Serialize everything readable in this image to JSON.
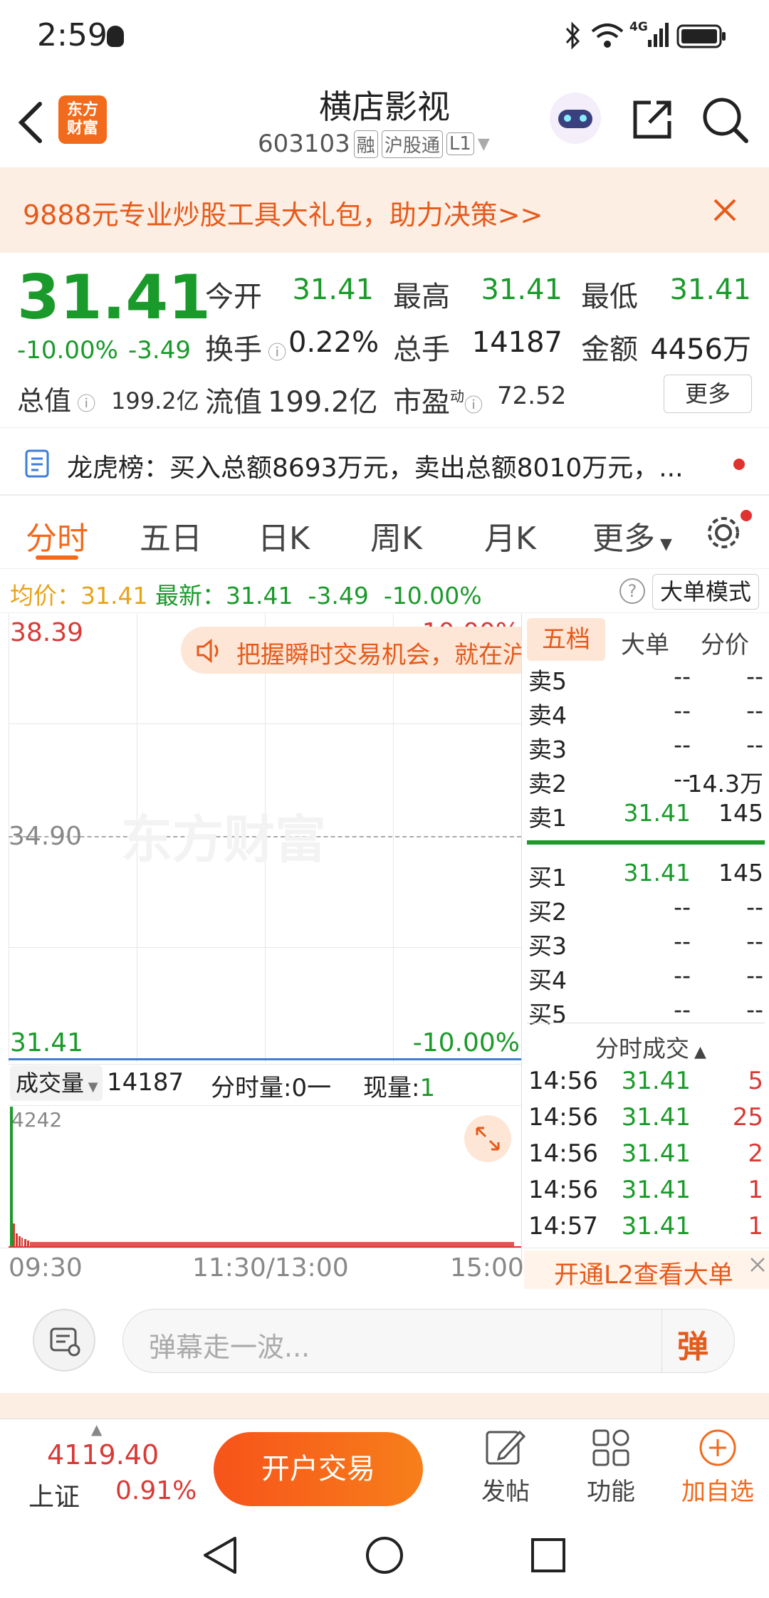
{
  "status_bar": {
    "time": "2:59",
    "network": "4G"
  },
  "header": {
    "title": "横店影视",
    "code": "603103",
    "tags": [
      "融",
      "沪股通",
      "L1"
    ],
    "logo_text": "东方\n财富"
  },
  "banner": {
    "text": "9888元专业炒股工具大礼包，助力决策>>"
  },
  "quote": {
    "price": "31.41",
    "change_pct": "-10.00%",
    "change": "-3.49",
    "open_label": "今开",
    "open": "31.41",
    "high_label": "最高",
    "high": "31.41",
    "low_label": "最低",
    "low": "31.41",
    "turnover_label": "换手",
    "turnover": "0.22%",
    "volume_label": "总手",
    "volume": "14187",
    "amount_label": "金额",
    "amount": "4456万",
    "mktcap_label": "总值",
    "mktcap": "199.2亿",
    "float_label": "流值",
    "float": "199.2亿",
    "pe_label": "市盈",
    "pe_sup": "动",
    "pe": "72.52",
    "more_button": "更多"
  },
  "news": {
    "text": "龙虎榜：买入总额8693万元，卖出总额8010万元，..."
  },
  "tabs": [
    "分时",
    "五日",
    "日K",
    "周K",
    "月K",
    "更多"
  ],
  "info_line": {
    "avg_label": "均价：",
    "avg": "31.41",
    "latest_label": "最新：",
    "latest": "31.41",
    "change": "-3.49",
    "change_pct": "-10.00%",
    "mode_button": "大单模式"
  },
  "chart": {
    "top_price": "38.39",
    "top_pct": "10.00%",
    "mid_price": "34.90",
    "bottom_price": "31.41",
    "bottom_pct": "-10.00%",
    "watermark": "东方财富",
    "promo": "把握瞬时交易机会，就在沪",
    "volume_label": "成交量",
    "volume": "14187",
    "minute_vol_label": "分时量:0一",
    "current_vol_label": "现量:",
    "current_vol": "1",
    "vol_max": "4242",
    "time_labels": [
      "09:30",
      "11:30/13:00",
      "15:00"
    ]
  },
  "order_book": {
    "tabs": [
      "五档",
      "大单",
      "分价"
    ],
    "sell": [
      {
        "label": "卖5",
        "price": "--",
        "vol": "--"
      },
      {
        "label": "卖4",
        "price": "--",
        "vol": "--"
      },
      {
        "label": "卖3",
        "price": "--",
        "vol": "--"
      },
      {
        "label": "卖2",
        "price": "--",
        "vol": "14.3万"
      },
      {
        "label": "卖1",
        "price": "31.41",
        "vol": "145"
      }
    ],
    "buy": [
      {
        "label": "买1",
        "price": "31.41",
        "vol": "145"
      },
      {
        "label": "买2",
        "price": "--",
        "vol": "--"
      },
      {
        "label": "买3",
        "price": "--",
        "vol": "--"
      },
      {
        "label": "买4",
        "price": "--",
        "vol": "--"
      },
      {
        "label": "买5",
        "price": "--",
        "vol": "--"
      }
    ]
  },
  "deals": {
    "title": "分时成交",
    "rows": [
      {
        "time": "14:56",
        "price": "31.41",
        "vol": "5"
      },
      {
        "time": "14:56",
        "price": "31.41",
        "vol": "25"
      },
      {
        "time": "14:56",
        "price": "31.41",
        "vol": "2"
      },
      {
        "time": "14:56",
        "price": "31.41",
        "vol": "1"
      },
      {
        "time": "14:57",
        "price": "31.41",
        "vol": "1"
      }
    ],
    "l2_promo": "开通L2查看大单"
  },
  "comment": {
    "placeholder": "弹幕走一波...",
    "danmu_button": "弹"
  },
  "bottom_bar": {
    "index_value": "4119.40",
    "index_name": "上证",
    "index_pct": "0.91%",
    "trade_button": "开户交易",
    "post": "发帖",
    "functions": "功能",
    "add_watch": "加自选"
  },
  "colors": {
    "accent": "#f26a1b",
    "up": "#d93a36",
    "down": "#1a9a2a",
    "avg": "#e8a317"
  }
}
